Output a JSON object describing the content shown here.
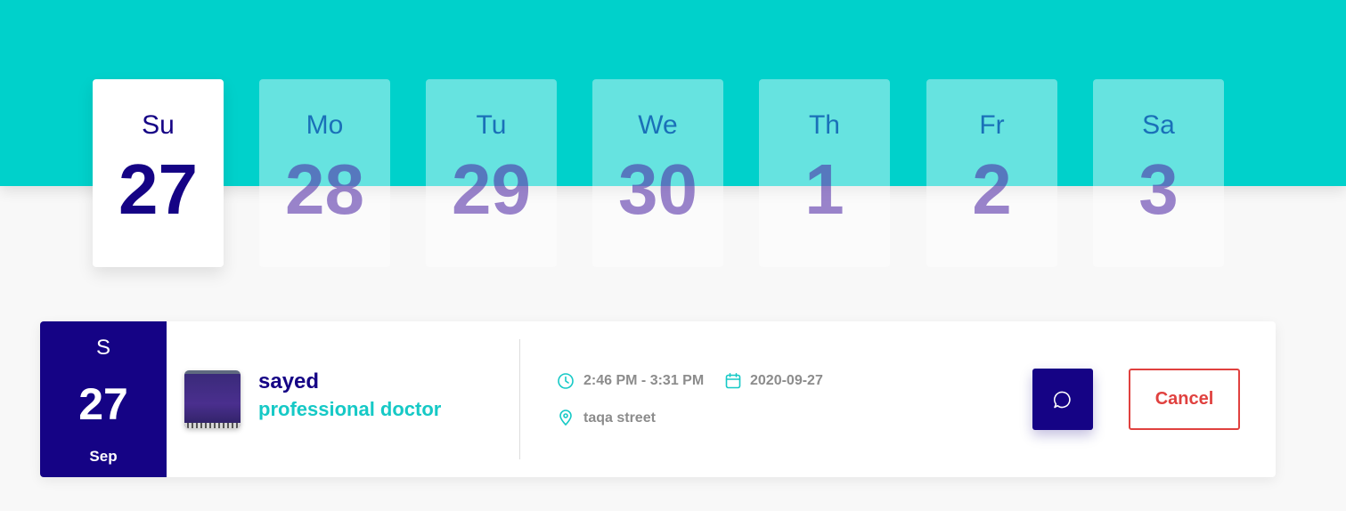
{
  "week": [
    {
      "name": "Su",
      "num": "27"
    },
    {
      "name": "Mo",
      "num": "28"
    },
    {
      "name": "Tu",
      "num": "29"
    },
    {
      "name": "We",
      "num": "30"
    },
    {
      "name": "Th",
      "num": "1"
    },
    {
      "name": "Fr",
      "num": "2"
    },
    {
      "name": "Sa",
      "num": "3"
    }
  ],
  "appointment": {
    "weekday": "S",
    "day": "27",
    "month": "Sep",
    "doctor_name": "sayed",
    "doctor_title": "professional doctor",
    "time": "2:46 PM - 3:31 PM",
    "date": "2020-09-27",
    "location": "taqa street",
    "cancel_label": "Cancel"
  },
  "colors": {
    "header_bg": "#00d1cb",
    "primary": "#150385",
    "accent": "#16c9c6",
    "danger": "#e0413f"
  },
  "icons": {
    "time": "clock-icon",
    "date": "calendar-icon",
    "location": "map-pin-icon",
    "chat": "chat-icon"
  }
}
